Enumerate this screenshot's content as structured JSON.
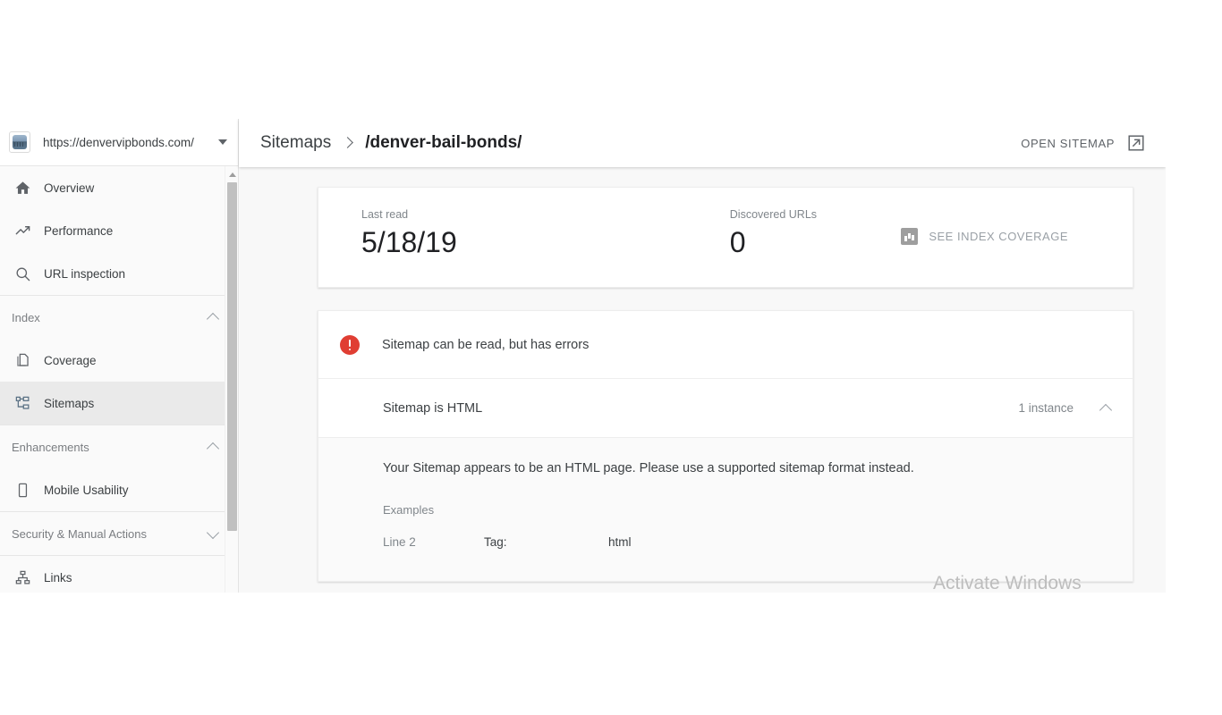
{
  "sidebar": {
    "property": {
      "icon": "site-favicon",
      "url": "https://denvervipbonds.com/",
      "dropdown_icon": "caret-down-icon"
    },
    "items": [
      {
        "label": "Overview",
        "icon": "home-icon",
        "type": "item",
        "selected": false
      },
      {
        "label": "Performance",
        "icon": "trending-up-icon",
        "type": "item",
        "selected": false
      },
      {
        "label": "URL inspection",
        "icon": "search-icon",
        "type": "item",
        "selected": false
      },
      {
        "label": "Index",
        "icon": "chevron-up-icon",
        "type": "section",
        "expanded": true
      },
      {
        "label": "Coverage",
        "icon": "pages-icon",
        "type": "item",
        "selected": false
      },
      {
        "label": "Sitemaps",
        "icon": "sitemap-icon",
        "type": "item",
        "selected": true
      },
      {
        "label": "Enhancements",
        "icon": "chevron-up-icon",
        "type": "section",
        "expanded": true
      },
      {
        "label": "Mobile Usability",
        "icon": "mobile-icon",
        "type": "item",
        "selected": false
      },
      {
        "label": "Security & Manual Actions",
        "icon": "chevron-down-icon",
        "type": "section",
        "expanded": false
      },
      {
        "label": "Links",
        "icon": "links-icon",
        "type": "item",
        "selected": false
      }
    ]
  },
  "header": {
    "breadcrumb_root": "Sitemaps",
    "breadcrumb_separator": "chevron-right-icon",
    "breadcrumb_current": "/denver-bail-bonds/",
    "open_sitemap_label": "OPEN SITEMAP",
    "open_sitemap_icon": "external-link-icon"
  },
  "stats": {
    "last_read_label": "Last read",
    "last_read_value": "5/18/19",
    "discovered_label": "Discovered URLs",
    "discovered_value": "0",
    "see_index_coverage_label": "SEE INDEX COVERAGE",
    "see_index_coverage_icon": "bar-chart-icon"
  },
  "error_card": {
    "status_icon": "error-circle-icon",
    "status_color": "#e03e33",
    "status_message": "Sitemap can be read, but has errors",
    "issue": {
      "name": "Sitemap is HTML",
      "count_label": "1 instance",
      "toggle_icon": "chevron-up-icon",
      "expanded": true,
      "description": "Your Sitemap appears to be an HTML page. Please use a supported sitemap format instead.",
      "examples_label": "Examples",
      "examples": [
        {
          "line": "Line 2",
          "tag_key": "Tag:",
          "tag_value": "html"
        }
      ]
    }
  },
  "watermark": {
    "text": "Activate Windows"
  }
}
